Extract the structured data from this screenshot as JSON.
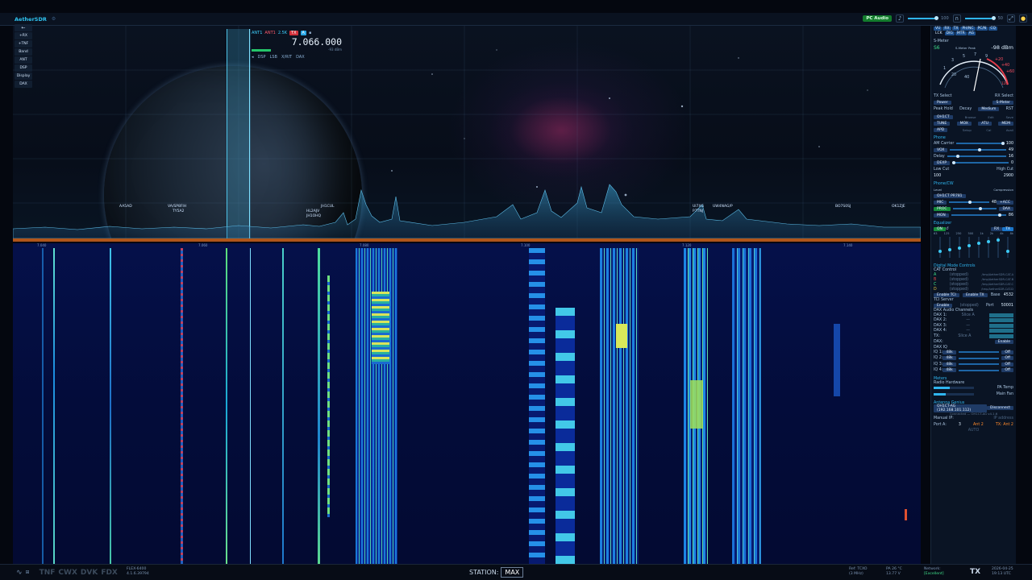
{
  "app": {
    "title": "AetherSDR",
    "window_menu": "Slice A"
  },
  "top_right": {
    "pc_audio": "PC Audio",
    "vol_1": "100",
    "vol_2": "50"
  },
  "left_panel": {
    "items": [
      "+RX",
      "+TNF",
      "Band",
      "ANT",
      "DSP",
      "Display",
      "DAX"
    ]
  },
  "slice": {
    "ant_rx": "ANT1",
    "ant_tx": "ANT1",
    "bandwidth": "2.5K",
    "tx_badge": "TX",
    "letter": "A",
    "frequency": "7.066.000",
    "dbm": "-93 dBm",
    "mode_items": [
      "DSP",
      "LSB",
      "X/RIT",
      "DAX"
    ]
  },
  "spots": [
    "AA5AD",
    "VA/SP8FIH",
    "TY5A2",
    "JH1CUL",
    "HL2AJV",
    "JH1OHQ",
    "UI7XG",
    "P7TNJ",
    "UW4NAG/P",
    "BO7S0SJ",
    "OK1ZJE"
  ],
  "freq_ticks": [
    "7.040",
    "7.060",
    "7.080",
    "7.100",
    "7.120",
    "7.140"
  ],
  "right_panel": {
    "rx_chips": [
      "VU",
      "RX",
      "TX",
      "PH/NC",
      "PC/N",
      "CQ",
      "LCK",
      "DIG",
      "MTR",
      "AG"
    ],
    "s_meter_title": "S-Meter",
    "s_value": "S6",
    "s_peak_label": "S-Meter Peak",
    "s_dbm": "-98 dBm",
    "gauge_labels": [
      "1",
      "3",
      "5",
      "7",
      "9",
      "+20",
      "+40",
      "+60",
      "20",
      "40",
      "60",
      "80",
      "100",
      "120"
    ],
    "tx_select_label": "TX Select",
    "rx_select_label": "RX Select",
    "power": "Power",
    "meter_sel": "S-Meter",
    "peak_hold": "Peak Hold",
    "decay": "Decay",
    "decay_val": "Medium",
    "rst": "RST",
    "callsign": "OH1CT",
    "callsign_opts": [
      "Browse",
      "Edit",
      "Save"
    ],
    "tx_buttons": [
      "TUNE",
      "MOX",
      "ATU",
      "MEM"
    ],
    "apd": "APD",
    "apd_opts": [
      "Setup",
      "Cal",
      "Avail"
    ],
    "phone_title": "Phone",
    "am_carrier": "AM Carrier",
    "am_carrier_val": "100",
    "vox": "VOX",
    "vox_val": "49",
    "delay": "Delay",
    "delay_val": "16",
    "dexp": "DEXP",
    "dexp_val": "0",
    "low_cut": "Low Cut",
    "high_cut": "High Cut",
    "tx_low": "100",
    "tx_high": "2900",
    "phonecw_title": "Phone/CW",
    "level_label": "Level",
    "compression_label": "Compression",
    "profile": "OH1CT PR781",
    "mic": "MIC",
    "mic_val": "48",
    "acc": "+ACC",
    "proc": "PROC",
    "dax_btn": "DAX",
    "mon": "MON",
    "mon_val": "86",
    "eq_title": "Equalizer",
    "eq_on": "ON",
    "eq_rx": "RX",
    "eq_tx": "TX",
    "eq_freqs": [
      "63",
      "125",
      "250",
      "500",
      "1k",
      "2k",
      "4k",
      "8k"
    ],
    "digital_title": "Digital Mode Controls",
    "cat_title": "CAT Control",
    "cat_rows": [
      {
        "ch": "A",
        "state": "(stopped)",
        "path": "/tmp/AetherSDR-CAT-A"
      },
      {
        "ch": "B",
        "state": "(stopped)",
        "path": "/tmp/AetherSDR-CAT-B"
      },
      {
        "ch": "C",
        "state": "(stopped)",
        "path": "/tmp/AetherSDR-CAT-C"
      },
      {
        "ch": "D",
        "state": "(stopped)",
        "path": "/tmp/AetherSDR-CAT-D"
      }
    ],
    "enable_tci": "Enable TCI",
    "enable_tx": "Enable TX",
    "base": "Base",
    "base_val": "4532",
    "tci_title": "TCI Server",
    "enable": "Enable",
    "tci_state": "(stopped)",
    "port": "Port",
    "port_val": "50001",
    "dax_audio_title": "DAX Audio Channels",
    "dax_channels": [
      {
        "label": "DAX 1:",
        "val": "Slice A"
      },
      {
        "label": "DAX 2:",
        "val": "—"
      },
      {
        "label": "DAX 3:",
        "val": "—"
      },
      {
        "label": "DAX 4:",
        "val": "—"
      },
      {
        "label": "TX:",
        "val": "Slice A"
      }
    ],
    "dax_label": "DAX:",
    "dax_enable": "Enable",
    "dax_iq_title": "DAX IQ",
    "iq_rows": [
      {
        "label": "IQ 1:",
        "rate": "48k",
        "state": "Off"
      },
      {
        "label": "IQ 2:",
        "rate": "48k",
        "state": "Off"
      },
      {
        "label": "IQ 3:",
        "rate": "48k",
        "state": "Off"
      },
      {
        "label": "IQ 4:",
        "rate": "48k",
        "state": "Off"
      }
    ],
    "meters_title": "Meters",
    "radio_hw": "Radio Hardware",
    "pa_temp": "PA Temp",
    "main_fan": "Main Fan",
    "antenna_title": "Antenna Genius",
    "ag_device": "OH1CT-AG (192.168.101.112)",
    "disconnect": "Disconnect",
    "ag_connected": "Connected — OH1CT-AG v4.1.6",
    "manual_ip": "Manual IP:",
    "ip_placeholder": "IP address",
    "port_a": "Port A:",
    "port_a_val": "3",
    "port_b": "Ant 2",
    "tx_ant": "TX: Ant 2",
    "auto": "AUTO"
  },
  "bottom": {
    "modes": [
      "TNF",
      "CWX",
      "DVK",
      "FDX"
    ],
    "radio_model": "FLEX-6400",
    "radio_ver": "4.1.6.39794",
    "station_label": "STATION:",
    "station_value": "MAX",
    "ref": "Ref: TCXO",
    "ref_sub": "(3 MHz)",
    "pa": "PA 26 °C",
    "volts": "13.77 V",
    "network": "Network:",
    "network_val": "[Excellent]",
    "tx": "TX",
    "date": "2026-04-25",
    "time": "19:13 UTC"
  },
  "colors": {
    "accent": "#2fb5ef",
    "tx_red": "#d1303a",
    "green": "#168a3c",
    "freq_bar": "#b0551a"
  }
}
